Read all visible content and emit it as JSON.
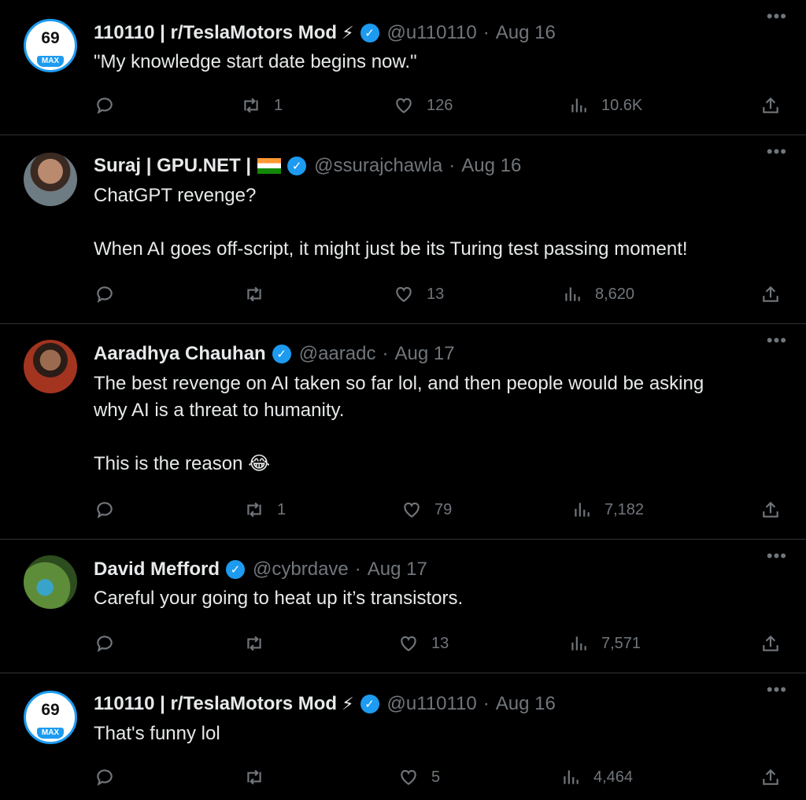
{
  "tweets": [
    {
      "name": "110110 | r/TeslaMotors Mod",
      "emoji": "⚡",
      "handle": "@u110110",
      "sep": "·",
      "time": "Aug 16",
      "avatar_badge": "69",
      "avatar_max": "MAX",
      "text": "\"My knowledge start date begins now.\"",
      "retweets": "1",
      "likes": "126",
      "views": "10.6K"
    },
    {
      "name": "Suraj | GPU.NET |",
      "handle": "@ssurajchawla",
      "sep": "·",
      "time": "Aug 16",
      "text": "ChatGPT revenge?\n\nWhen AI goes off-script, it might just be its Turing test passing moment!",
      "retweets": "",
      "likes": "13",
      "views": "8,620"
    },
    {
      "name": "Aaradhya Chauhan",
      "handle": "@aaradc",
      "sep": "·",
      "time": "Aug 17",
      "text": "The best revenge on AI taken so far lol, and then people would be asking\nwhy AI is a threat to humanity.\n\nThis is the reason 😂",
      "retweets": "1",
      "likes": "79",
      "views": "7,182"
    },
    {
      "name": "David Mefford",
      "handle": "@cybrdave",
      "sep": "·",
      "time": "Aug 17",
      "text": "Careful your going to heat up it’s transistors.",
      "retweets": "",
      "likes": "13",
      "views": "7,571"
    },
    {
      "name": "110110 | r/TeslaMotors Mod",
      "emoji": "⚡",
      "handle": "@u110110",
      "sep": "·",
      "time": "Aug 16",
      "avatar_badge": "69",
      "avatar_max": "MAX",
      "text": "That's funny lol",
      "retweets": "",
      "likes": "5",
      "views": "4,464"
    }
  ],
  "more_icon": "•••",
  "verified_icon": "✓",
  "colors": {
    "background": "#000000",
    "text": "#e7e9ea",
    "muted": "#71767b",
    "verified": "#1d9bf0",
    "divider": "#2f3336"
  }
}
